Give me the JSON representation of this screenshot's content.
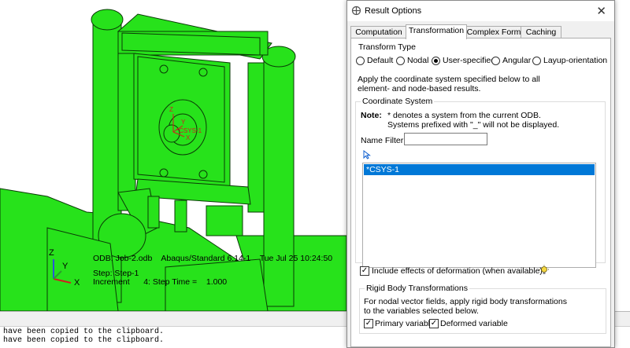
{
  "viewport": {
    "odb_line": "ODB: Job-2.odb    Abaqus/Standard 6.14-1    Tue Jul 25 10:24:50",
    "step_line": "Step: Step-1",
    "increment_line": "Increment      4: Step Time =    1.000",
    "triad_x": "X",
    "triad_y": "Y",
    "triad_z": "Z",
    "csys_z": "Z",
    "csys_y": "Y",
    "csys_x": "X",
    "csys_label": "*CSYS-1",
    "model_color": "#27e21b"
  },
  "message_area": {
    "lines": [
      "have been copied to the clipboard.",
      "have been copied to the clipboard."
    ]
  },
  "dialog": {
    "title": "Result Options",
    "close_glyph": "✕",
    "tabs": [
      "Computation",
      "Transformation",
      "Complex Form",
      "Caching"
    ],
    "active_tab": "Transformation",
    "transform_type": {
      "label": "Transform Type",
      "options": [
        "Default",
        "Nodal",
        "User-specified",
        "Angular",
        "Layup-orientation"
      ],
      "selected": "User-specified"
    },
    "apply_text_1": "Apply the coordinate system specified below to all",
    "apply_text_2": "element- and node-based results.",
    "coord_system": {
      "label": "Coordinate System",
      "note_label": "Note:",
      "note_1": "* denotes a system from the current ODB.",
      "note_2": "Systems prefixed with \"_\" will not be displayed.",
      "name_filter_label": "Name Filter",
      "name_filter_value": "",
      "items": [
        "*CSYS-1"
      ],
      "selected_item": "*CSYS-1"
    },
    "include_deformation": {
      "label": "Include effects of deformation (when available)",
      "checked": true
    },
    "rigid_body": {
      "label": "Rigid Body Transformations",
      "text_1": "For nodal vector fields, apply rigid body transformations",
      "text_2": "to the variables selected below.",
      "primary_label": "Primary variable",
      "primary_checked": true,
      "deformed_label": "Deformed variable",
      "deformed_checked": true
    },
    "accent_color": "#0078d7"
  }
}
